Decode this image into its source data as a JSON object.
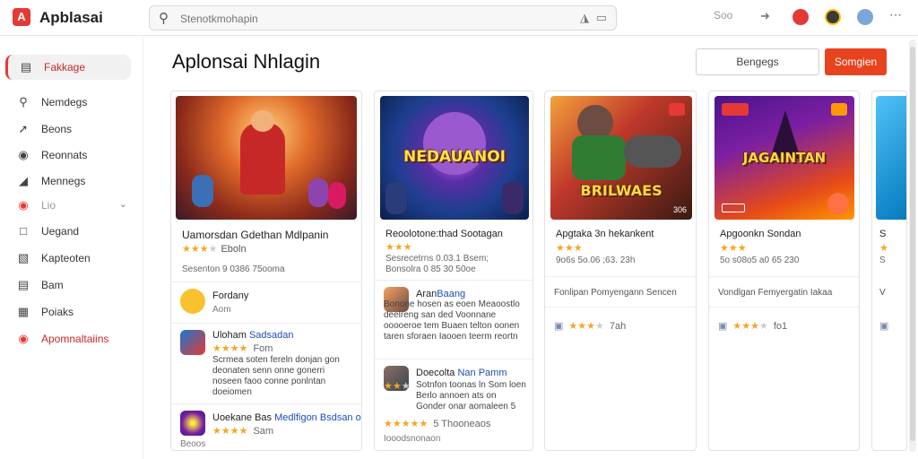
{
  "app": {
    "logo_letter": "A",
    "title": "Apblasai"
  },
  "search": {
    "placeholder": "Stenotkmohapin"
  },
  "toolbar": {
    "label": "Soo"
  },
  "colors": {
    "accent": "#e8431f",
    "brand": "#e53935",
    "star": "#f5a623",
    "link": "#1e4db7"
  },
  "sidebar": {
    "items": [
      {
        "label": "Fakkage",
        "icon": "grid-icon",
        "active": true
      },
      {
        "label": "Nemdegs",
        "icon": "search-icon"
      },
      {
        "label": "Beons",
        "icon": "trend-icon"
      },
      {
        "label": "Reonnats",
        "icon": "circle-icon"
      },
      {
        "label": "Mennegs",
        "icon": "bookmark-icon"
      },
      {
        "label": "Lio",
        "icon": "record-icon"
      },
      {
        "label": "Uegand",
        "icon": "folder-icon"
      },
      {
        "label": "Kapteoten",
        "icon": "lock-icon"
      },
      {
        "label": "Bam",
        "icon": "list-icon"
      },
      {
        "label": "Poiaks",
        "icon": "doc-icon"
      },
      {
        "label": "Apomnaltaiins",
        "icon": "settings-icon"
      }
    ]
  },
  "main": {
    "title": "Aplonsai Nhlagin",
    "secondary_button": "Bengegs",
    "primary_button": "Somgien"
  },
  "cards": [
    {
      "cover_word": "",
      "title": "Uamorsdan Gdethan Mdlpanin",
      "rating": 3,
      "rating_value": "Eboln",
      "meta": "Sesenton 9 0386 75ooma",
      "reviews": [
        {
          "name": "Fordany",
          "name_blue": "",
          "stars": 0,
          "value": "",
          "text": "",
          "sub": "Aom"
        },
        {
          "name": "Uloham",
          "name_blue": "Sadsadan",
          "stars": 4,
          "value": "Fom",
          "text": "Scrmea soten fereln donjan gon deonaten senn onne gonerri noseen faoo conne ponlntan doeiomen",
          "sub": ""
        },
        {
          "name": "Uoekane Bas",
          "name_blue": "Medlfigon Bsdsan oo",
          "stars": 4,
          "value": "Sam",
          "text": "",
          "sub": "Beoos"
        }
      ]
    },
    {
      "cover_word": "NEDAUANOI",
      "title": "Reoolotone:thad Sootagan",
      "rating": 3,
      "rating_value": "",
      "meta": "Sesrecetrns 0.03.1 Bsem; Bonsolra 0 85 30  50oe",
      "reviews": [
        {
          "name": "Aran",
          "name_blue": "Baang",
          "stars": 0,
          "value": "",
          "text": "Bonone hosen as eoen Meaoostlo deelreng san ded Voonnane ooooeroe tem Buaen telton oonen taren sforaen Iaooen teerm reortn",
          "sub": ""
        },
        {
          "name": "Doecolta",
          "name_blue": "Nan Pamm",
          "stars": 2,
          "value": "",
          "text": "Sotnfon toonas ln Som loen Berlo annoen ats on Gonder onar aomaleen 5",
          "sub": ""
        },
        {
          "name": "",
          "name_blue": "",
          "stars": 5,
          "value": "5 Thooneaos",
          "text": "",
          "sub": "Iooodsnonaon"
        }
      ]
    },
    {
      "cover_word": "BRILWAES",
      "cover_tag": "306",
      "title": "Apgtaka 3n hekankent",
      "rating": 3,
      "rating_value": "",
      "meta": "9o6s 5o.06 ;63. 23h",
      "description": "Fonlipan Pomyengann Sencen",
      "bottom_rating": 3,
      "bottom_value": "7ah"
    },
    {
      "cover_word": "JAGAINTAN",
      "title": "Apgoonkn Sondan",
      "rating": 3,
      "rating_value": "",
      "meta": "5o s08o5 a0 65 230",
      "description": "Vondlgan Femyergatin Iakaa",
      "bottom_rating": 3,
      "bottom_value": "fo1"
    },
    {
      "cover_word": "",
      "title": "S",
      "rating": 1,
      "rating_value": "",
      "meta": "S",
      "description": "V",
      "bottom_rating": 0,
      "bottom_value": ""
    }
  ]
}
